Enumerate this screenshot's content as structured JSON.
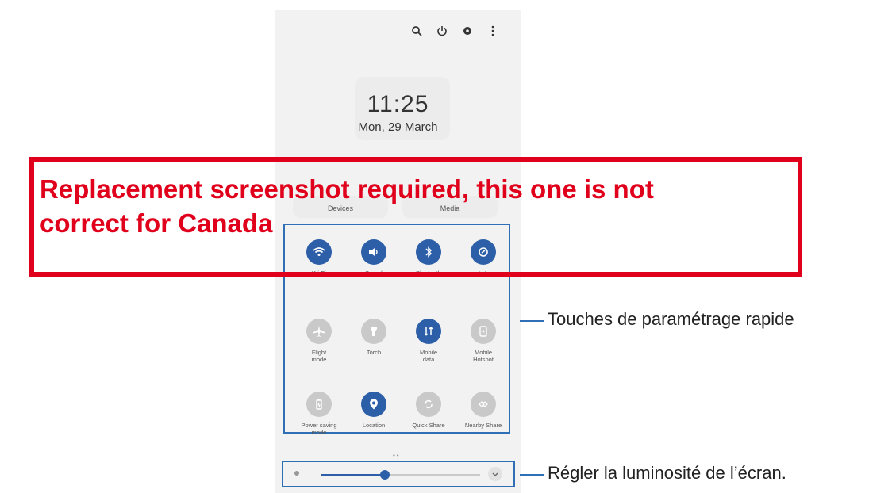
{
  "clock": {
    "time": "11:25",
    "date": "Mon, 29 March"
  },
  "top_icons": [
    "search-icon",
    "power-icon",
    "gear-icon",
    "more-vertical-icon"
  ],
  "pills": {
    "devices": "Devices",
    "media": "Media"
  },
  "tiles": [
    {
      "label": "Wi-Fi",
      "icon": "wifi-icon",
      "state": "on"
    },
    {
      "label": "Sound",
      "icon": "speaker-icon",
      "state": "on"
    },
    {
      "label": "Bluetooth",
      "icon": "bluetooth-icon",
      "state": "on"
    },
    {
      "label": "Auto",
      "icon": "auto-rotate-icon",
      "state": "on"
    },
    {
      "label": "Flight\nmode",
      "icon": "airplane-icon",
      "state": "off"
    },
    {
      "label": "Torch",
      "icon": "flashlight-icon",
      "state": "off"
    },
    {
      "label": "Mobile\ndata",
      "icon": "mobile-data-icon",
      "state": "on"
    },
    {
      "label": "Mobile\nHotspot",
      "icon": "hotspot-icon",
      "state": "off"
    },
    {
      "label": "Power saving\nmode",
      "icon": "battery-icon",
      "state": "off"
    },
    {
      "label": "Location",
      "icon": "location-icon",
      "state": "on"
    },
    {
      "label": "Quick Share",
      "icon": "quick-share-icon",
      "state": "off"
    },
    {
      "label": "Nearby Share",
      "icon": "nearby-share-icon",
      "state": "off"
    }
  ],
  "brightness": {
    "level": 0.4
  },
  "callouts": {
    "quick_settings": "Touches de paramétrage rapide",
    "brightness": "Régler la luminosité de l’écran."
  },
  "overlay": {
    "text": "Replacement screenshot required, this one is not\ncorrect for Canada",
    "color": "#e0001b"
  },
  "colors": {
    "accent": "#2c5fa8",
    "frame": "#2f6fb5",
    "inactive": "#c9c9c9"
  }
}
